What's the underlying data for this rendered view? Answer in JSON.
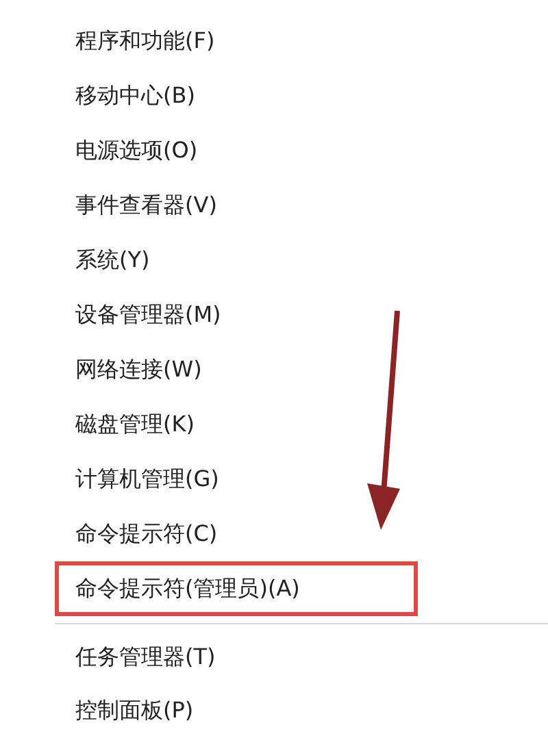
{
  "menu": {
    "groups": [
      [
        {
          "label": "程序和功能(F)",
          "boxed": false
        },
        {
          "label": "移动中心(B)",
          "boxed": false
        },
        {
          "label": "电源选项(O)",
          "boxed": false
        },
        {
          "label": "事件查看器(V)",
          "boxed": false
        },
        {
          "label": "系统(Y)",
          "boxed": false
        },
        {
          "label": "设备管理器(M)",
          "boxed": false
        },
        {
          "label": "网络连接(W)",
          "boxed": false
        },
        {
          "label": "磁盘管理(K)",
          "boxed": false
        },
        {
          "label": "计算机管理(G)",
          "boxed": false
        },
        {
          "label": "命令提示符(C)",
          "boxed": false
        },
        {
          "label": "命令提示符(管理员)(A)",
          "boxed": true
        }
      ],
      [
        {
          "label": "任务管理器(T)",
          "boxed": false
        },
        {
          "label": "控制面板(P)",
          "boxed": false
        }
      ]
    ]
  }
}
